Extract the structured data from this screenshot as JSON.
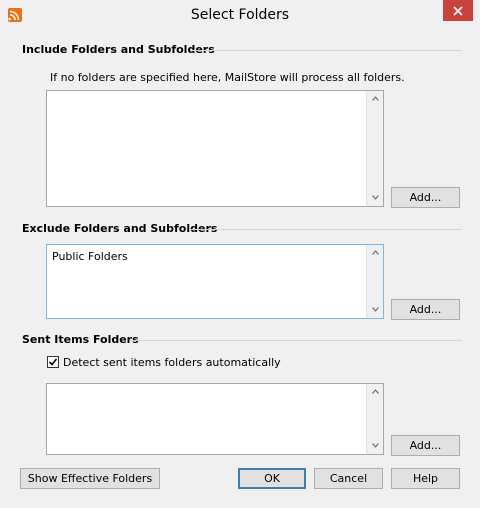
{
  "window": {
    "title": "Select Folders",
    "icon": "mailstore-icon",
    "accent": "#c9423c"
  },
  "include": {
    "title": "Include Folders and Subfolders",
    "hint": "If no folders are specified here, MailStore will process all folders.",
    "items": [],
    "add_label": "Add..."
  },
  "exclude": {
    "title": "Exclude Folders and Subfolders",
    "items": [
      "Public Folders"
    ],
    "add_label": "Add..."
  },
  "sent": {
    "title": "Sent Items Folders",
    "checkbox_label": "Detect sent items folders automatically",
    "checkbox_checked": true,
    "items": [],
    "add_label": "Add..."
  },
  "footer": {
    "show_effective_label": "Show Effective Folders",
    "ok_label": "OK",
    "cancel_label": "Cancel",
    "help_label": "Help"
  }
}
